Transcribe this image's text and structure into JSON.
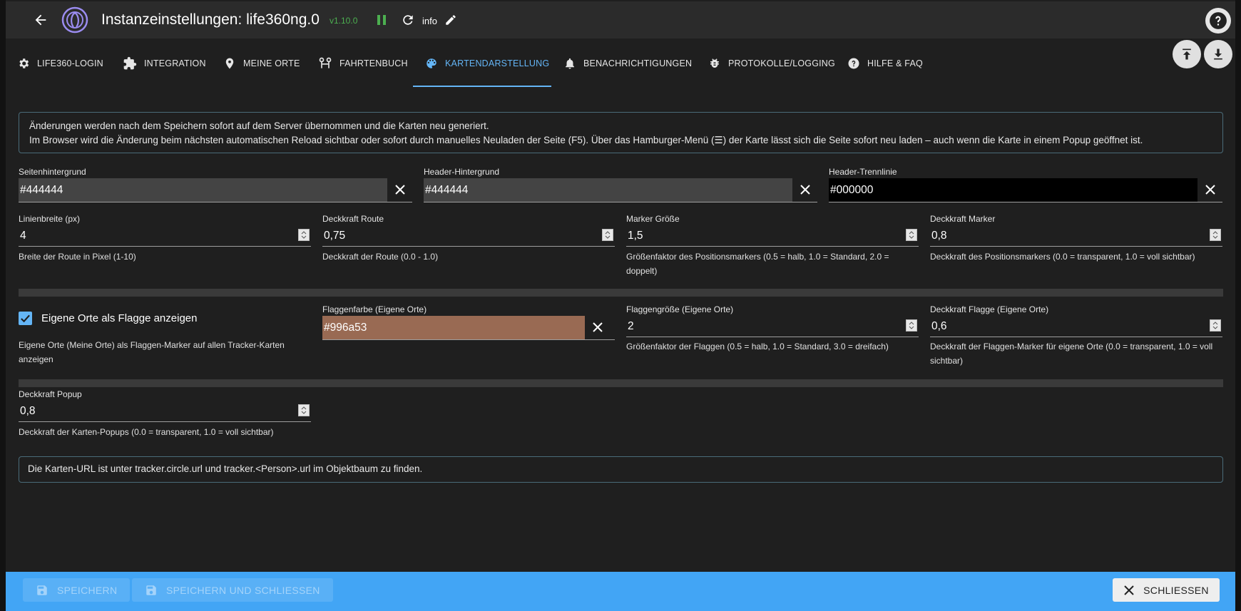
{
  "header": {
    "title": "Instanzeinstellungen:  life360ng.0",
    "version": "v1.10.0",
    "info_label": "info"
  },
  "tabs": [
    {
      "label": "LIFE360-LOGIN",
      "icon": "gear-icon"
    },
    {
      "label": "INTEGRATION",
      "icon": "puzzle-icon"
    },
    {
      "label": "MEINE ORTE",
      "icon": "map-marker-icon"
    },
    {
      "label": "FAHRTENBUCH",
      "icon": "route-icon"
    },
    {
      "label": "KARTENDARSTELLUNG",
      "icon": "palette-icon",
      "active": true
    },
    {
      "label": "BENACHRICHTIGUNGEN",
      "icon": "bell-icon"
    },
    {
      "label": "PROTOKOLLE/LOGGING",
      "icon": "bug-icon"
    },
    {
      "label": "HILFE & FAQ",
      "icon": "help-circle-icon"
    }
  ],
  "notice": {
    "line1": "Änderungen werden nach dem Speichern sofort auf dem Server übernommen und die Karten neu generiert.",
    "line2": "Im Browser wird die Änderung beim nächsten automatischen Reload sichtbar oder sofort durch manuelles Neuladen der Seite (F5). Über das Hamburger-Menü (☰) der Karte lässt sich die Seite sofort neu laden – auch wenn die Karte in einem Popup geöffnet ist."
  },
  "colors": {
    "page_bg": {
      "label": "Seitenhintergrund",
      "value": "#444444"
    },
    "header_bg": {
      "label": "Header-Hintergrund",
      "value": "#444444"
    },
    "header_line": {
      "label": "Header-Trennlinie",
      "value": "#000000"
    }
  },
  "numbers_row1": [
    {
      "label": "Linienbreite (px)",
      "value": "4",
      "helper": "Breite der Route in Pixel (1-10)"
    },
    {
      "label": "Deckkraft Route",
      "value": "0,75",
      "helper": "Deckkraft der Route (0.0 - 1.0)"
    },
    {
      "label": "Marker Größe",
      "value": "1,5",
      "helper": "Größenfaktor des Positionsmarkers (0.5 = halb, 1.0 = Standard, 2.0 = doppelt)"
    },
    {
      "label": "Deckkraft Marker",
      "value": "0,8",
      "helper": "Deckkraft des Positionsmarkers (0.0 = transparent, 1.0 = voll sichtbar)"
    }
  ],
  "flag": {
    "checkbox_label": "Eigene Orte als Flagge anzeigen",
    "checkbox_checked": true,
    "checkbox_helper": "Eigene Orte (Meine Orte) als Flaggen-Marker auf allen Tracker-Karten anzeigen",
    "color_label": "Flaggenfarbe (Eigene Orte)",
    "color_value": "#996a53",
    "size_label": "Flaggengröße (Eigene Orte)",
    "size_value": "2",
    "size_helper": "Größenfaktor der Flaggen (0.5 = halb, 1.0 = Standard, 3.0 = dreifach)",
    "opacity_label": "Deckkraft Flagge (Eigene Orte)",
    "opacity_value": "0,6",
    "opacity_helper": "Deckkraft der Flaggen-Marker für eigene Orte (0.0 = transparent, 1.0 = voll sichtbar)"
  },
  "popup": {
    "label": "Deckkraft Popup",
    "value": "0,8",
    "helper": "Deckkraft der Karten-Popups (0.0 = transparent, 1.0 = voll sichtbar)"
  },
  "notice2": "Die Karten-URL ist unter tracker.circle.url und tracker.<Person>.url im Objektbaum zu finden.",
  "footer": {
    "save_label": "SPEICHERN",
    "save_close_label": "SPEICHERN UND SCHLIESSEN",
    "close_label": "SCHLIESSEN"
  },
  "theme": {
    "accent": "#64b5f6",
    "footer_bg": "#42a5f5",
    "version_color": "#4caf50",
    "field_bg": "#444444",
    "header_line_bg": "#000000",
    "flag_color_bg": "#996a53"
  }
}
